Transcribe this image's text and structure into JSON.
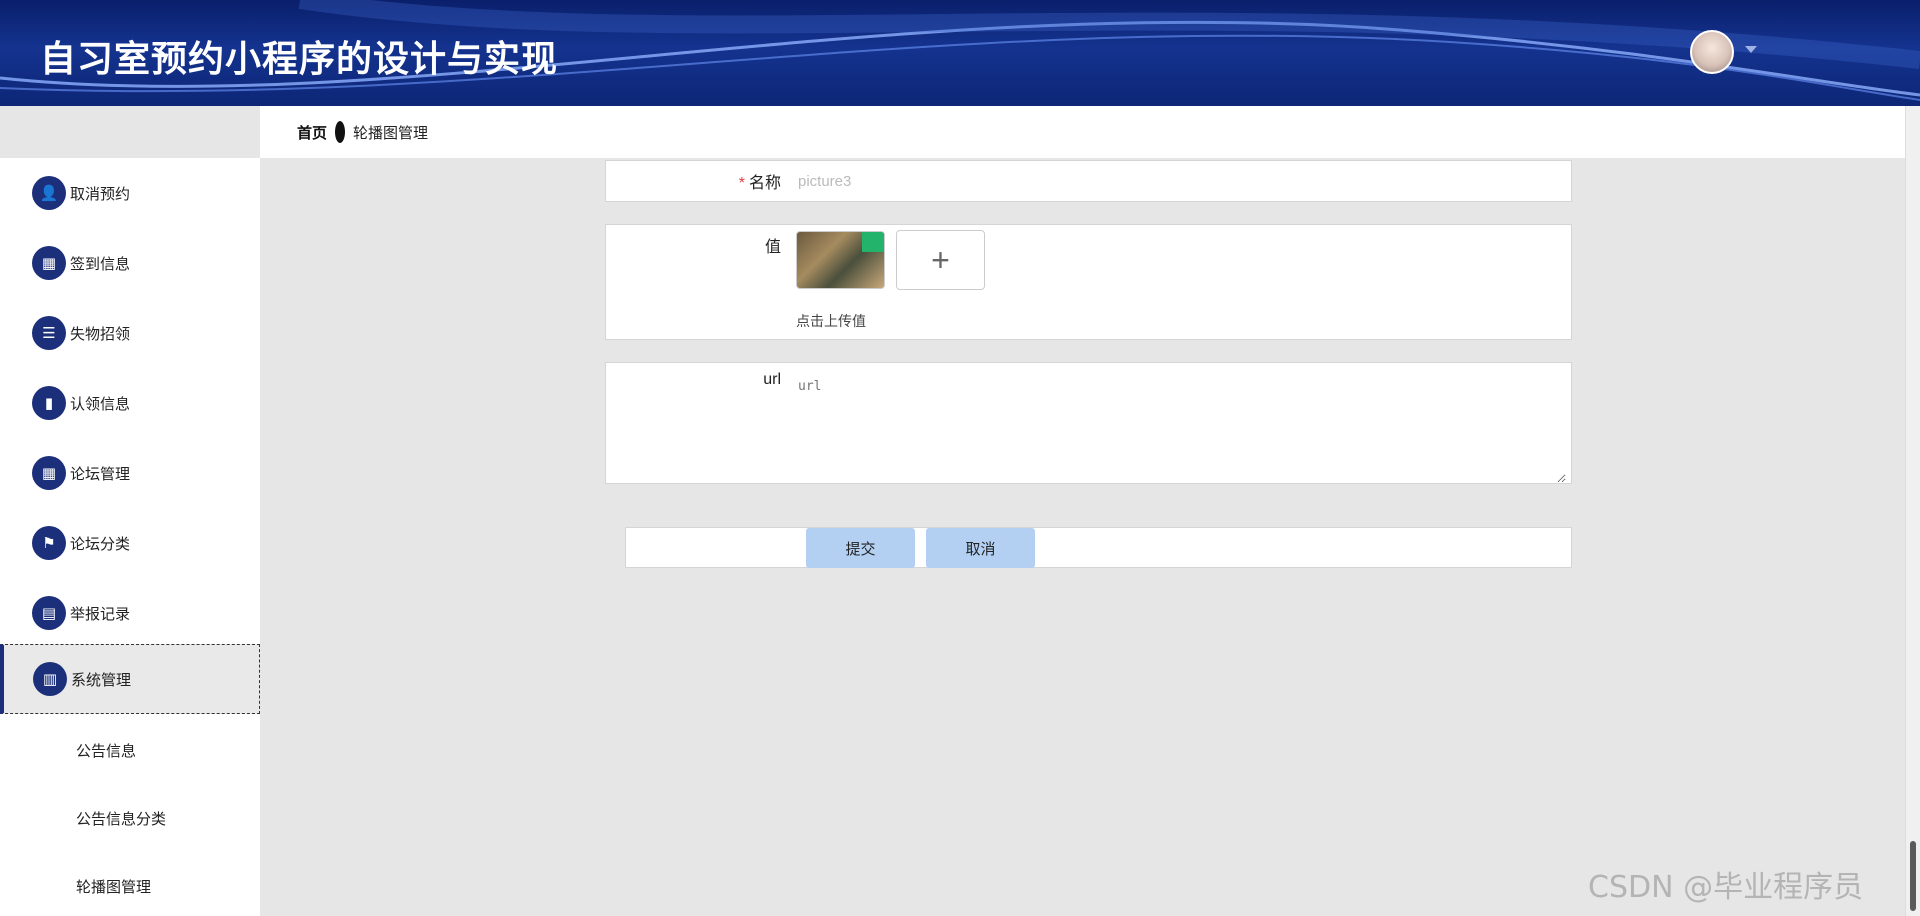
{
  "app": {
    "title": "自习室预约小程序的设计与实现"
  },
  "breadcrumb": {
    "home": "首页",
    "current": "轮播图管理"
  },
  "sidebar": {
    "items": [
      {
        "label": "取消预约",
        "icon": "user-icon",
        "glyph": "👤"
      },
      {
        "label": "签到信息",
        "icon": "grid-icon",
        "glyph": "▦"
      },
      {
        "label": "失物招领",
        "icon": "list-icon",
        "glyph": "☰"
      },
      {
        "label": "认领信息",
        "icon": "book-icon",
        "glyph": "▮"
      },
      {
        "label": "论坛管理",
        "icon": "grid-icon",
        "glyph": "▦"
      },
      {
        "label": "论坛分类",
        "icon": "flag-icon",
        "glyph": "⚑"
      },
      {
        "label": "举报记录",
        "icon": "clipboard-icon",
        "glyph": "▤"
      },
      {
        "label": "系统管理",
        "icon": "bar-chart-icon",
        "glyph": "▥",
        "active": true
      }
    ],
    "sub_items": [
      {
        "label": "公告信息"
      },
      {
        "label": "公告信息分类"
      },
      {
        "label": "轮播图管理"
      }
    ]
  },
  "form": {
    "name": {
      "label": "名称",
      "required_mark": "*",
      "value": "picture3"
    },
    "value": {
      "label": "值",
      "upload_tip": "点击上传值",
      "plus": "+"
    },
    "url": {
      "label": "url",
      "placeholder": "url"
    },
    "submit_label": "提交",
    "cancel_label": "取消"
  },
  "watermark": "CSDN @毕业程序员",
  "colors": {
    "header": "#14338f",
    "menu_icon": "#1c2f7a",
    "button": "#b3d0f2"
  }
}
